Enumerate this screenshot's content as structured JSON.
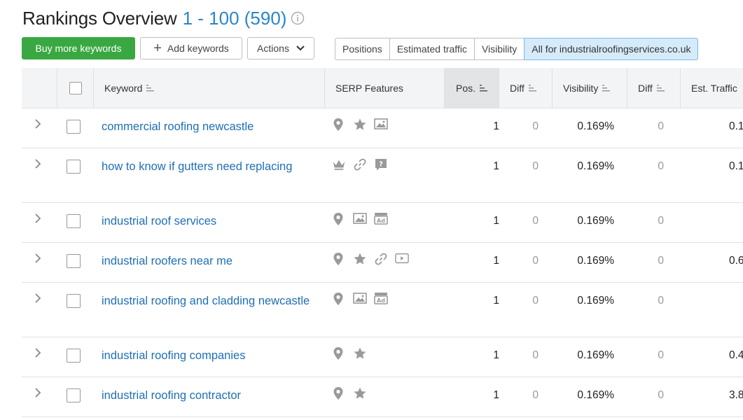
{
  "header": {
    "title": "Rankings Overview",
    "range": "1 - 100 (590)"
  },
  "toolbar": {
    "buy_label": "Buy more keywords",
    "add_label": "Add keywords",
    "actions_label": "Actions",
    "segments": [
      "Positions",
      "Estimated traffic",
      "Visibility",
      "All for industrialroofingservices.co.uk"
    ],
    "active_segment": "All for industrialroofingservices.co.uk"
  },
  "table": {
    "columns": {
      "keyword": "Keyword",
      "serp": "SERP Features",
      "pos": "Pos.",
      "diff": "Diff",
      "visibility": "Visibility",
      "diff2": "Diff",
      "traffic": "Est. Traffic"
    },
    "rows": [
      {
        "keyword": "commercial roofing newcastle",
        "icons": [
          "pin-icon",
          "star-icon",
          "image-icon"
        ],
        "pos": "1",
        "diff": "0",
        "visibility": "0.169%",
        "diff2": "0",
        "traffic": "0.1"
      },
      {
        "keyword": "how to know if gutters need replacing",
        "icons": [
          "crown-icon",
          "link-icon",
          "question-icon"
        ],
        "pos": "1",
        "diff": "0",
        "visibility": "0.169%",
        "diff2": "0",
        "traffic": "0.1"
      },
      {
        "keyword": "industrial roof services",
        "icons": [
          "pin-icon",
          "image-icon",
          "ad-icon"
        ],
        "pos": "1",
        "diff": "0",
        "visibility": "0.169%",
        "diff2": "0",
        "traffic": ""
      },
      {
        "keyword": "industrial roofers near me",
        "icons": [
          "pin-icon",
          "star-icon",
          "link-icon",
          "video-icon"
        ],
        "pos": "1",
        "diff": "0",
        "visibility": "0.169%",
        "diff2": "0",
        "traffic": "0.6"
      },
      {
        "keyword": "industrial roofing and cladding newcastle",
        "icons": [
          "pin-icon",
          "image-icon",
          "ad-icon"
        ],
        "pos": "1",
        "diff": "0",
        "visibility": "0.169%",
        "diff2": "0",
        "traffic": ""
      },
      {
        "keyword": "industrial roofing companies",
        "icons": [
          "pin-icon",
          "star-icon"
        ],
        "pos": "1",
        "diff": "0",
        "visibility": "0.169%",
        "diff2": "0",
        "traffic": "0.4"
      },
      {
        "keyword": "industrial roofing contractor",
        "icons": [
          "pin-icon",
          "star-icon"
        ],
        "pos": "1",
        "diff": "0",
        "visibility": "0.169%",
        "diff2": "0",
        "traffic": "3.8"
      }
    ]
  },
  "colors": {
    "accent": "#2a86c8",
    "buy_button": "#3aa842",
    "active_segment_bg": "#d6ebfa",
    "keyword_link": "#1f6fb5"
  }
}
